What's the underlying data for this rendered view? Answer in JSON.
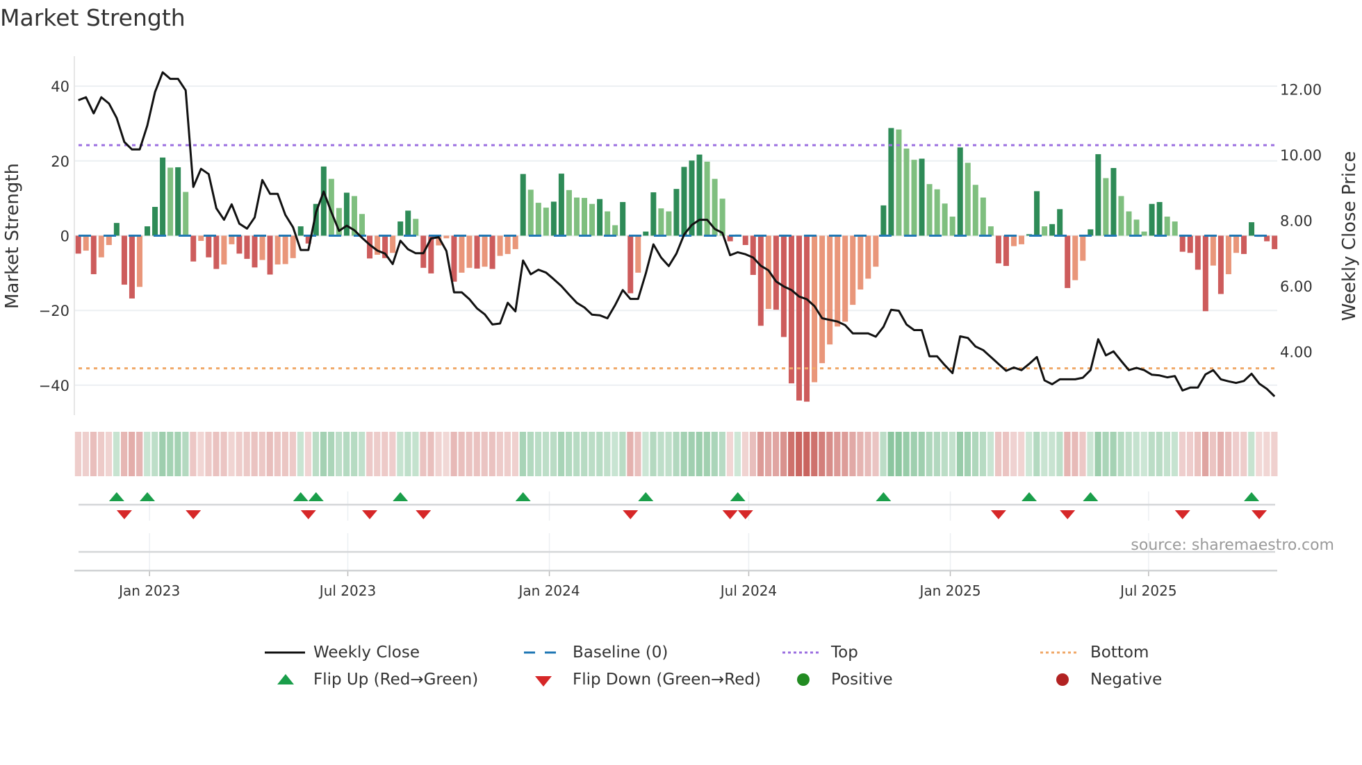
{
  "title": "Market Strength",
  "source": "source: sharemaestro.com",
  "colors": {
    "pos_strong": "#2e8b57",
    "pos_weak": "#7fbf7f",
    "neg_strong": "#cd5c5c",
    "neg_weak": "#e9967a",
    "close_line": "#111111",
    "baseline": "#1f77b4",
    "top": "#9b6fe0",
    "bottom": "#f0a868",
    "flip_up": "#1a9e4a",
    "flip_down": "#d62728",
    "positive": "#228b22",
    "negative": "#b22222",
    "grid": "#eceff2"
  },
  "legend": [
    {
      "label": "Weekly Close",
      "symbol": "line-solid"
    },
    {
      "label": "Baseline (0)",
      "symbol": "line-dashed"
    },
    {
      "label": "Top",
      "symbol": "line-dotted-purple"
    },
    {
      "label": "Bottom",
      "symbol": "line-dotted-orange"
    },
    {
      "label": "Flip Up (Red→Green)",
      "symbol": "triangle-up"
    },
    {
      "label": "Flip Down (Green→Red)",
      "symbol": "triangle-down"
    },
    {
      "label": "Positive",
      "symbol": "circle-green"
    },
    {
      "label": "Negative",
      "symbol": "circle-red"
    }
  ],
  "chart_data": {
    "type": "bar",
    "title": "Market Strength",
    "x_start": "2022-10-28",
    "x_step_days": 7,
    "strength": [
      -4.8,
      -4.0,
      -10.3,
      -5.8,
      -2.5,
      3.4,
      -13.1,
      -16.8,
      -13.7,
      2.5,
      7.7,
      20.9,
      18.2,
      18.3,
      11.7,
      -6.9,
      -1.4,
      -5.8,
      -8.9,
      -7.7,
      -2.3,
      -4.8,
      -6.2,
      -8.5,
      -6.5,
      -10.4,
      -7.7,
      -7.6,
      -6.0,
      2.5,
      -2.1,
      8.5,
      18.5,
      15.2,
      7.4,
      11.5,
      10.6,
      5.8,
      -6.1,
      -5.1,
      -6.0,
      -4.6,
      3.8,
      6.7,
      4.5,
      -8.6,
      -10.1,
      -2.6,
      -0.7,
      -12.3,
      -9.9,
      -8.6,
      -8.8,
      -8.3,
      -8.9,
      -5.4,
      -4.9,
      -3.6,
      16.5,
      12.3,
      8.8,
      7.5,
      9.1,
      16.6,
      12.2,
      10.2,
      10.1,
      8.5,
      9.8,
      6.5,
      2.8,
      9.0,
      -15.4,
      -9.9,
      1.1,
      11.6,
      7.3,
      6.5,
      12.5,
      18.4,
      20.1,
      21.7,
      19.8,
      15.2,
      9.9,
      -1.5,
      0.3,
      -2.5,
      -10.5,
      -24.1,
      -19.6,
      -19.8,
      -27.1,
      -39.5,
      -44.1,
      -44.4,
      -39.2,
      -34.1,
      -29.1,
      -24.3,
      -23.0,
      -18.5,
      -14.4,
      -11.5,
      -8.3,
      8.1,
      28.8,
      28.4,
      23.3,
      20.3,
      20.6,
      13.8,
      12.4,
      8.6,
      5.1,
      23.6,
      19.5,
      13.6,
      10.2,
      2.5,
      -7.4,
      -8.1,
      -2.8,
      -2.3,
      0.4,
      11.9,
      2.5,
      3.1,
      7.1,
      -14.0,
      -11.9,
      -6.7,
      1.7,
      21.8,
      15.4,
      18.1,
      10.6,
      6.5,
      4.3,
      1.1,
      8.5,
      9.0,
      5.1,
      3.8,
      -4.3,
      -4.6,
      -9.1,
      -20.2,
      -8.0,
      -15.6,
      -10.3,
      -4.6,
      -4.9,
      3.6,
      -0.3,
      -1.5,
      -3.6
    ],
    "close": [
      11.66,
      11.75,
      11.26,
      11.75,
      11.56,
      11.12,
      10.39,
      10.16,
      10.16,
      10.89,
      11.91,
      12.51,
      12.31,
      12.31,
      11.96,
      9.02,
      9.57,
      9.41,
      8.37,
      8.02,
      8.49,
      7.9,
      7.75,
      8.09,
      9.23,
      8.81,
      8.81,
      8.17,
      7.79,
      7.1,
      7.1,
      8.25,
      8.88,
      8.25,
      7.68,
      7.84,
      7.7,
      7.47,
      7.26,
      7.08,
      6.99,
      6.67,
      7.38,
      7.12,
      7.0,
      7.0,
      7.45,
      7.49,
      7.07,
      5.81,
      5.81,
      5.6,
      5.32,
      5.14,
      4.83,
      4.86,
      5.49,
      5.23,
      6.78,
      6.36,
      6.5,
      6.41,
      6.21,
      6.0,
      5.74,
      5.49,
      5.35,
      5.13,
      5.11,
      5.02,
      5.42,
      5.88,
      5.61,
      5.61,
      6.38,
      7.27,
      6.87,
      6.61,
      6.99,
      7.57,
      7.86,
      8.02,
      8.02,
      7.74,
      7.62,
      6.94,
      7.03,
      6.97,
      6.87,
      6.62,
      6.48,
      6.14,
      5.99,
      5.88,
      5.68,
      5.6,
      5.39,
      5.02,
      4.97,
      4.92,
      4.81,
      4.56,
      4.56,
      4.56,
      4.46,
      4.76,
      5.28,
      5.25,
      4.83,
      4.66,
      4.66,
      3.86,
      3.86,
      3.59,
      3.35,
      4.47,
      4.42,
      4.16,
      4.05,
      3.84,
      3.63,
      3.42,
      3.52,
      3.44,
      3.63,
      3.84,
      3.13,
      3.01,
      3.16,
      3.16,
      3.16,
      3.21,
      3.44,
      4.38,
      3.89,
      4.01,
      3.72,
      3.44,
      3.51,
      3.44,
      3.3,
      3.28,
      3.22,
      3.26,
      2.82,
      2.91,
      2.91,
      3.31,
      3.44,
      3.16,
      3.1,
      3.05,
      3.11,
      3.33,
      3.03,
      2.87,
      2.64
    ],
    "top_level": 24.2,
    "bottom_level": -35.5,
    "baseline": 0,
    "left_axis": {
      "label": "Market Strength",
      "range": [
        -48,
        48
      ],
      "ticks": [
        {
          "value": 40,
          "label": "40"
        },
        {
          "value": 20,
          "label": "20"
        },
        {
          "value": 0,
          "label": "0"
        },
        {
          "value": -20,
          "label": "−20"
        },
        {
          "value": -40,
          "label": "−40"
        }
      ]
    },
    "right_axis": {
      "label": "Weekly Close Price",
      "range": [
        2.07,
        13.0
      ],
      "ticks": [
        {
          "value": 12,
          "label": "12.00"
        },
        {
          "value": 10,
          "label": "10.00"
        },
        {
          "value": 8,
          "label": "8.00"
        },
        {
          "value": 6,
          "label": "6.00"
        },
        {
          "value": 4,
          "label": "4.00"
        }
      ]
    },
    "x_ticks": [
      {
        "date": "2023-01-01",
        "label": "Jan 2023"
      },
      {
        "date": "2023-07-01",
        "label": "Jul 2023"
      },
      {
        "date": "2024-01-01",
        "label": "Jan 2024"
      },
      {
        "date": "2024-07-01",
        "label": "Jul 2024"
      },
      {
        "date": "2025-01-01",
        "label": "Jan 2025"
      },
      {
        "date": "2025-07-01",
        "label": "Jul 2025"
      }
    ],
    "grid": true,
    "legend_position": "bottom"
  }
}
